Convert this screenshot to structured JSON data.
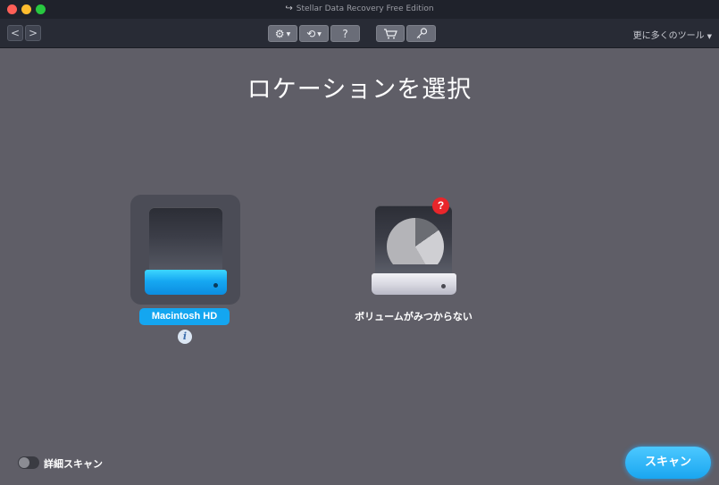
{
  "window": {
    "title": "Stellar Data Recovery Free Edition",
    "title_icon": "↪"
  },
  "toolbar": {
    "back": "<",
    "forward": ">",
    "settings_glyph": "⚙",
    "history_glyph": "⟲",
    "help_glyph": "?",
    "cart_glyph": "🛒",
    "key_glyph": "⚷",
    "more_tools": "更に多くのツール",
    "caret": "▼"
  },
  "main": {
    "title": "ロケーションを選択",
    "drives": [
      {
        "label": "Macintosh HD",
        "selected": true,
        "info_glyph": "i"
      },
      {
        "label": "ボリュームがみつからない",
        "badge": "?"
      }
    ]
  },
  "footer": {
    "deep_scan_label": "詳細スキャン",
    "deep_scan_on": false,
    "scan_button": "スキャン"
  },
  "colors": {
    "background": "#5f5e67",
    "titlebar": "#1f222b",
    "toolbar": "#282b35",
    "accent": "#14a6f0",
    "badge": "#e8262b"
  }
}
